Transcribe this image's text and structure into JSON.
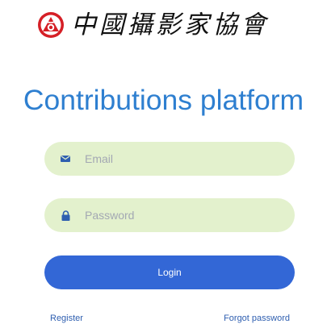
{
  "header": {
    "logo_text": "中國攝影家協會"
  },
  "title": "Contributions platform",
  "form": {
    "email": {
      "value": "",
      "placeholder": "Email",
      "icon": "envelope-icon"
    },
    "password": {
      "value": "",
      "placeholder": "Password",
      "icon": "lock-icon"
    },
    "login_label": "Login"
  },
  "links": {
    "register": "Register",
    "forgot_password": "Forgot password"
  },
  "colors": {
    "title": "#2e7fd0",
    "field_bg": "#e3f1cd",
    "button_bg": "#3367d6",
    "icon": "#2f5fb0",
    "emblem": "#d51f26"
  }
}
